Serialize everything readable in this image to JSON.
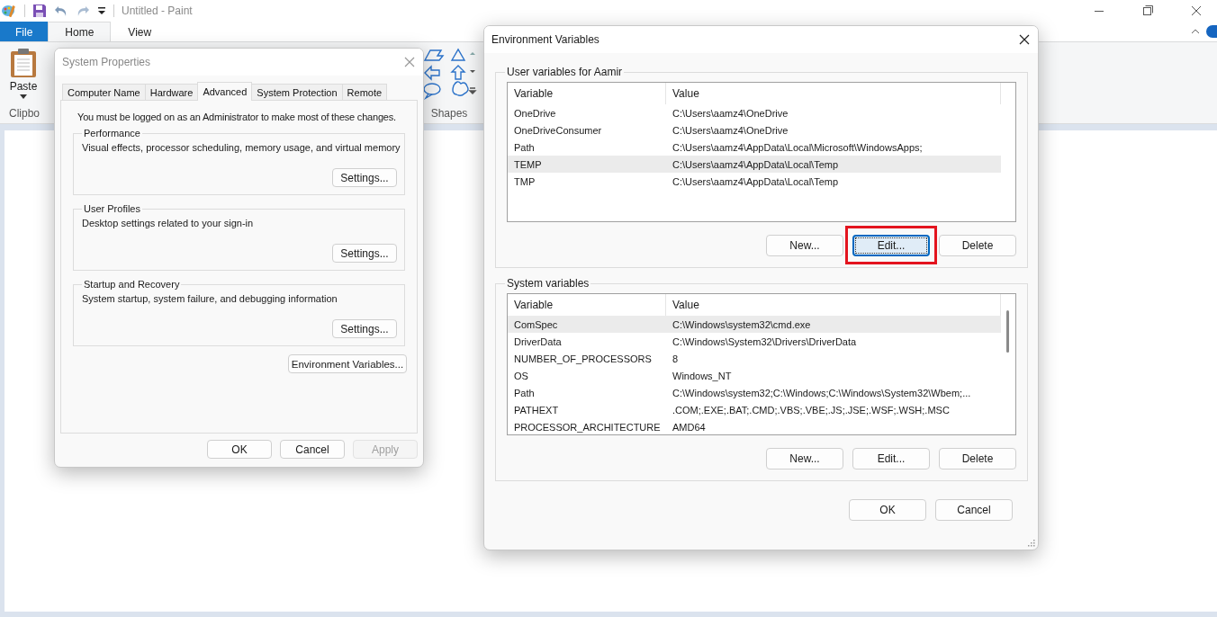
{
  "paint": {
    "title": "Untitled - Paint",
    "tabs": [
      {
        "label": "File",
        "kind": "file",
        "selected": false
      },
      {
        "label": "Home",
        "kind": "tab",
        "selected": true
      },
      {
        "label": "View",
        "kind": "tab",
        "selected": false
      }
    ],
    "ribbon": {
      "paste_label": "Paste",
      "clipboard_group": "Clipbo",
      "shapes_group": "Shapes"
    }
  },
  "system_properties": {
    "title": "System Properties",
    "tabs": [
      {
        "label": "Computer Name",
        "selected": false
      },
      {
        "label": "Hardware",
        "selected": false
      },
      {
        "label": "Advanced",
        "selected": true
      },
      {
        "label": "System Protection",
        "selected": false
      },
      {
        "label": "Remote",
        "selected": false
      }
    ],
    "notice": "You must be logged on as an Administrator to make most of these changes.",
    "groups": [
      {
        "title": "Performance",
        "description": "Visual effects, processor scheduling, memory usage, and virtual memory",
        "button": "Settings..."
      },
      {
        "title": "User Profiles",
        "description": "Desktop settings related to your sign-in",
        "button": "Settings..."
      },
      {
        "title": "Startup and Recovery",
        "description": "System startup, system failure, and debugging information",
        "button": "Settings..."
      }
    ],
    "env_button": "Environment Variables...",
    "buttons": [
      {
        "label": "OK",
        "disabled": false
      },
      {
        "label": "Cancel",
        "disabled": false
      },
      {
        "label": "Apply",
        "disabled": true
      }
    ]
  },
  "environment_variables": {
    "title": "Environment Variables",
    "user_group": {
      "title": "User variables for Aamir",
      "columns": [
        "Variable",
        "Value"
      ],
      "rows": [
        {
          "variable": "OneDrive",
          "value": "C:\\Users\\aamz4\\OneDrive",
          "selected": false
        },
        {
          "variable": "OneDriveConsumer",
          "value": "C:\\Users\\aamz4\\OneDrive",
          "selected": false
        },
        {
          "variable": "Path",
          "value": "C:\\Users\\aamz4\\AppData\\Local\\Microsoft\\WindowsApps;",
          "selected": false
        },
        {
          "variable": "TEMP",
          "value": "C:\\Users\\aamz4\\AppData\\Local\\Temp",
          "selected": true
        },
        {
          "variable": "TMP",
          "value": "C:\\Users\\aamz4\\AppData\\Local\\Temp",
          "selected": false
        }
      ],
      "buttons": [
        {
          "label": "New...",
          "focused": false,
          "highlighted": false
        },
        {
          "label": "Edit...",
          "focused": true,
          "highlighted": true
        },
        {
          "label": "Delete",
          "focused": false,
          "highlighted": false
        }
      ]
    },
    "system_group": {
      "title": "System variables",
      "columns": [
        "Variable",
        "Value"
      ],
      "rows": [
        {
          "variable": "ComSpec",
          "value": "C:\\Windows\\system32\\cmd.exe",
          "selected": true
        },
        {
          "variable": "DriverData",
          "value": "C:\\Windows\\System32\\Drivers\\DriverData",
          "selected": false
        },
        {
          "variable": "NUMBER_OF_PROCESSORS",
          "value": "8",
          "selected": false
        },
        {
          "variable": "OS",
          "value": "Windows_NT",
          "selected": false
        },
        {
          "variable": "Path",
          "value": "C:\\Windows\\system32;C:\\Windows;C:\\Windows\\System32\\Wbem;...",
          "selected": false
        },
        {
          "variable": "PATHEXT",
          "value": ".COM;.EXE;.BAT;.CMD;.VBS;.VBE;.JS;.JSE;.WSF;.WSH;.MSC",
          "selected": false
        },
        {
          "variable": "PROCESSOR_ARCHITECTURE",
          "value": "AMD64",
          "selected": false
        }
      ],
      "buttons": [
        {
          "label": "New...",
          "focused": false,
          "highlighted": false
        },
        {
          "label": "Edit...",
          "focused": false,
          "highlighted": false
        },
        {
          "label": "Delete",
          "focused": false,
          "highlighted": false
        }
      ]
    },
    "buttons": [
      "OK",
      "Cancel"
    ]
  }
}
